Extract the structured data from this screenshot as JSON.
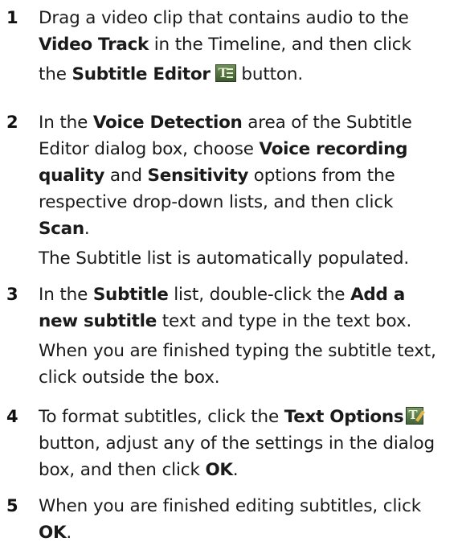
{
  "steps": [
    {
      "number": "1",
      "lines": [
        [
          "Drag a video clip that contains audio to the"
        ],
        [
          "",
          "Video Track",
          " in the Timeline, and then click"
        ],
        [
          "the ",
          "Subtitle Editor",
          " button."
        ]
      ]
    },
    {
      "number": "2",
      "lines": [
        [
          "In the ",
          "Voice Detection",
          " area of the Subtitle"
        ],
        [
          "Editor dialog box, choose ",
          "Voice recording"
        ],
        [
          "",
          "quality",
          " and ",
          "Sensitivity",
          " options from the"
        ],
        [
          "respective drop-down lists, and then click"
        ],
        [
          "",
          "Scan",
          "."
        ]
      ],
      "note": "The Subtitle list is automatically populated."
    },
    {
      "number": "3",
      "lines": [
        [
          "In the ",
          "Subtitle",
          " list, double-click the ",
          "Add a"
        ],
        [
          "",
          "new subtitle",
          " text and type in the text box."
        ]
      ],
      "note_lines": [
        "When you are finished typing the subtitle text,",
        "click outside the box."
      ]
    },
    {
      "number": "4",
      "lines": [
        [
          "To format subtitles, click the ",
          "Text Options",
          ""
        ],
        [
          "button, adjust any of the settings in the dialog"
        ],
        [
          "box, and then click ",
          "OK",
          "."
        ]
      ]
    },
    {
      "number": "5",
      "lines": [
        [
          "When you are finished editing subtitles, click"
        ],
        [
          "",
          "OK",
          "."
        ]
      ]
    }
  ],
  "icons": {
    "subtitle_editor": "subtitle-editor-icon",
    "text_options": "text-options-icon"
  }
}
